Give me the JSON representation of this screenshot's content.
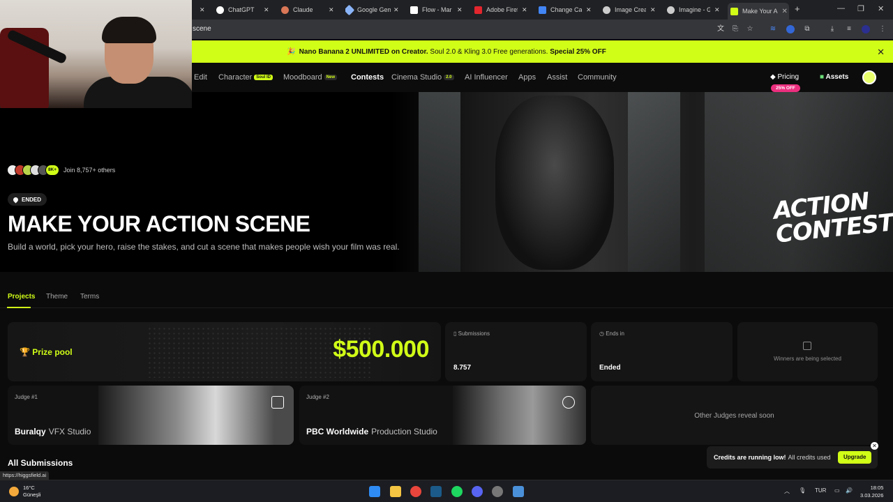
{
  "browser": {
    "tabs": [
      {
        "label": "ChatGPT",
        "icon": "chatgpt-icon",
        "color": "#ffffff"
      },
      {
        "label": "Claude",
        "icon": "claude-icon",
        "color": "#d97757"
      },
      {
        "label": "Google Gem",
        "icon": "gemini-icon",
        "color": "#8ab4f8"
      },
      {
        "label": "Flow - Mar (",
        "icon": "flow-icon",
        "color": "#ffffff"
      },
      {
        "label": "Adobe Firefl",
        "icon": "adobe-icon",
        "color": "#e3262e"
      },
      {
        "label": "Change Cam",
        "icon": "docs-icon",
        "color": "#4285f4"
      },
      {
        "label": "Image Creat",
        "icon": "image-icon",
        "color": "#cccccc"
      },
      {
        "label": "Imagine - Gr",
        "icon": "grok-icon",
        "color": "#cccccc"
      },
      {
        "label": "Make Your A",
        "icon": "higgsfield-icon",
        "color": "#d1fe17"
      }
    ],
    "url": "scene",
    "new_tab": "+"
  },
  "promo": {
    "icon": "🎉",
    "bold1": "Nano Banana 2 UNLIMITED on Creator.",
    "text": " Soul 2.0 & Kling 3.0 Free generations. ",
    "bold2": "Special 25% OFF"
  },
  "nav": {
    "items": [
      {
        "label": "Edit"
      },
      {
        "label": "Character",
        "badge": "Soul ID"
      },
      {
        "label": "Moodboard",
        "badge": "New"
      },
      {
        "label": "Contests"
      },
      {
        "label": "Cinema Studio",
        "badge": "2.0"
      },
      {
        "label": "AI Influencer"
      },
      {
        "label": "Apps"
      },
      {
        "label": "Assist"
      },
      {
        "label": "Community"
      }
    ],
    "pricing": "Pricing",
    "pricing_badge": "25% OFF",
    "assets": "Assets"
  },
  "hero": {
    "join_count": "8K+",
    "join_text": "Join 8,757+ others",
    "status": "ENDED",
    "title": "MAKE YOUR ACTION SCENE",
    "subtitle": "Build a world, pick your hero, raise the stakes, and cut a scene that makes people wish your film was real.",
    "logo_line1": "ACTION",
    "logo_line2": "CONTEST"
  },
  "section_tabs": [
    "Projects",
    "Theme",
    "Terms"
  ],
  "stats": {
    "prize_label": "Prize pool",
    "prize_value": "$500.000",
    "submissions_label": "Submissions",
    "submissions_value": "8.757",
    "ends_label": "Ends in",
    "ends_value": "Ended",
    "winners_text": "Winners are being selected"
  },
  "judges": [
    {
      "label": "Judge #1",
      "name": "Buralqy",
      "role": "VFX Studio"
    },
    {
      "label": "Judge #2",
      "name": "PBC Worldwide",
      "role": "Production Studio"
    }
  ],
  "other_judges": "Other Judges reveal soon",
  "all_submissions": "All Submissions",
  "status_url": "https://higgsfield.ai",
  "toast": {
    "bold": "Credits are running low!",
    "text": "All credits used",
    "button": "Upgrade"
  },
  "taskbar": {
    "temp": "16°C",
    "weather": "Güneşli",
    "lang": "TUR",
    "time": "18:05",
    "date": "3.03.2026"
  },
  "colors": {
    "accent": "#d1fe17",
    "badge_pink": "#ec2f7f",
    "background": "#0b0b0b"
  }
}
